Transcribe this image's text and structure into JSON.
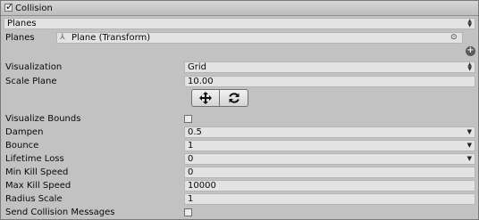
{
  "header": {
    "title": "Collision",
    "enabled": true
  },
  "planes_dropdown": {
    "value": "Planes"
  },
  "planes_row": {
    "label": "Planes",
    "value": "Plane (Transform)"
  },
  "visualization": {
    "label": "Visualization",
    "value": "Grid"
  },
  "scale_plane": {
    "label": "Scale Plane",
    "value": "10.00"
  },
  "tool_buttons": {
    "move_icon": "move-arrows-icon",
    "rotate_icon": "refresh-icon"
  },
  "properties": {
    "visualize_bounds": {
      "label": "Visualize Bounds",
      "checked": false
    },
    "dampen": {
      "label": "Dampen",
      "value": "0.5"
    },
    "bounce": {
      "label": "Bounce",
      "value": "1"
    },
    "lifetime_loss": {
      "label": "Lifetime Loss",
      "value": "0"
    },
    "min_kill_speed": {
      "label": "Min Kill Speed",
      "value": "0"
    },
    "max_kill_speed": {
      "label": "Max Kill Speed",
      "value": "10000"
    },
    "radius_scale": {
      "label": "Radius Scale",
      "value": "1"
    },
    "send_collision_messages": {
      "label": "Send Collision Messages",
      "checked": false
    }
  },
  "colors": {
    "panel_bg": "#c2c2c2",
    "field_bg": "#e3e3e3",
    "header_bg": "#cfcfcf"
  }
}
